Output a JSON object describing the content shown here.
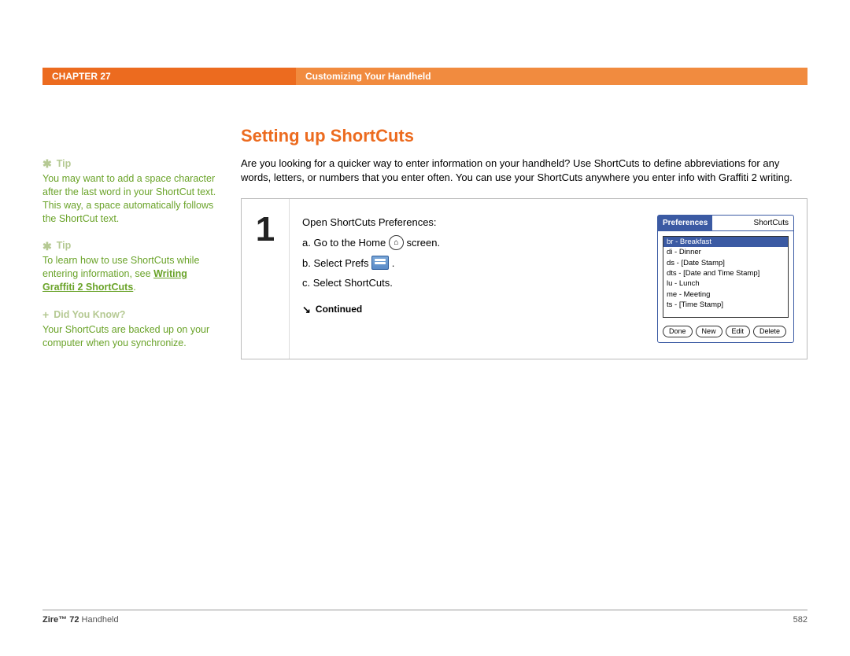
{
  "header": {
    "chapter": "CHAPTER 27",
    "title": "Customizing Your Handheld"
  },
  "sidebar": {
    "tips": [
      {
        "label": "Tip",
        "text": "You may want to add a space character after the last word in your ShortCut text. This way, a space automatically follows the ShortCut text."
      },
      {
        "label": "Tip",
        "text_before": "To learn how to use ShortCuts while entering information, see ",
        "link": "Writing Graffiti 2 ShortCuts",
        "text_after": "."
      }
    ],
    "dyk": {
      "label": "Did You Know?",
      "text": "Your ShortCuts are backed up on your computer when you synchronize."
    }
  },
  "main": {
    "title": "Setting up ShortCuts",
    "intro": "Are you looking for a quicker way to enter information on your handheld? Use ShortCuts to define abbreviations for any words, letters, or numbers that you enter often. You can use your ShortCuts anywhere you enter info with Graffiti 2 writing.",
    "step": {
      "number": "1",
      "lead": "Open ShortCuts Preferences:",
      "a_before": "a.  Go to the Home ",
      "a_after": " screen.",
      "b_before": "b.  Select Prefs ",
      "b_after": " .",
      "c": "c.  Select ShortCuts.",
      "continued": "Continued"
    },
    "device": {
      "tab_left": "Preferences",
      "tab_right": "ShortCuts",
      "items": [
        "br - Breakfast",
        "di - Dinner",
        "ds - [Date Stamp]",
        "dts - [Date and Time Stamp]",
        "lu - Lunch",
        "me - Meeting",
        "ts - [Time Stamp]"
      ],
      "buttons": [
        "Done",
        "New",
        "Edit",
        "Delete"
      ]
    }
  },
  "footer": {
    "product_bold": "Zire™ 72",
    "product_rest": " Handheld",
    "page": "582"
  }
}
